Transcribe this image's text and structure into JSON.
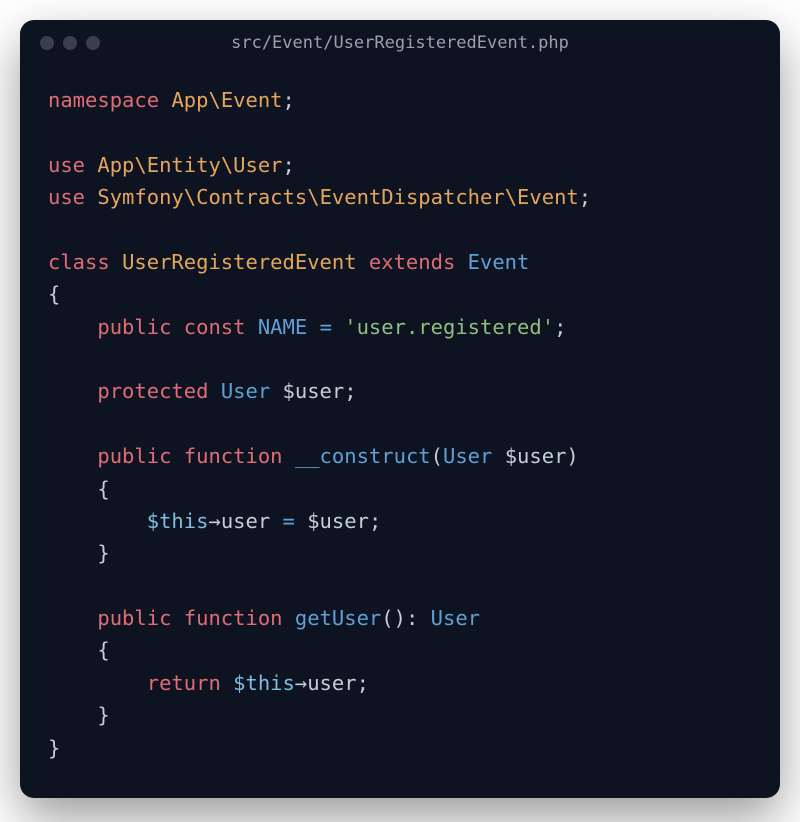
{
  "window": {
    "title": "src/Event/UserRegisteredEvent.php"
  },
  "code": {
    "namespace_kw": "namespace",
    "namespace_path_app": "App",
    "namespace_sep": "\\",
    "namespace_path_event": "Event",
    "semi": ";",
    "use_kw": "use",
    "use1_app": "App",
    "use1_entity": "Entity",
    "use1_user": "User",
    "use2_symfony": "Symfony",
    "use2_contracts": "Contracts",
    "use2_eventdispatcher": "EventDispatcher",
    "use2_event": "Event",
    "class_kw": "class",
    "class_name": "UserRegisteredEvent",
    "extends_kw": "extends",
    "extends_name": "Event",
    "brace_open": "{",
    "brace_close": "}",
    "public_kw": "public",
    "const_kw": "const",
    "const_name": "NAME",
    "equals": "=",
    "const_value": "'user.registered'",
    "protected_kw": "protected",
    "type_user": "User",
    "var_user": "$user",
    "function_kw": "function",
    "construct_name": "__construct",
    "paren_open": "(",
    "paren_close": ")",
    "this_var": "$this",
    "arrow": "→",
    "prop_user": "user",
    "getuser_name": "getUser",
    "paren_pair": "()",
    "colon": ":",
    "return_kw": "return"
  }
}
